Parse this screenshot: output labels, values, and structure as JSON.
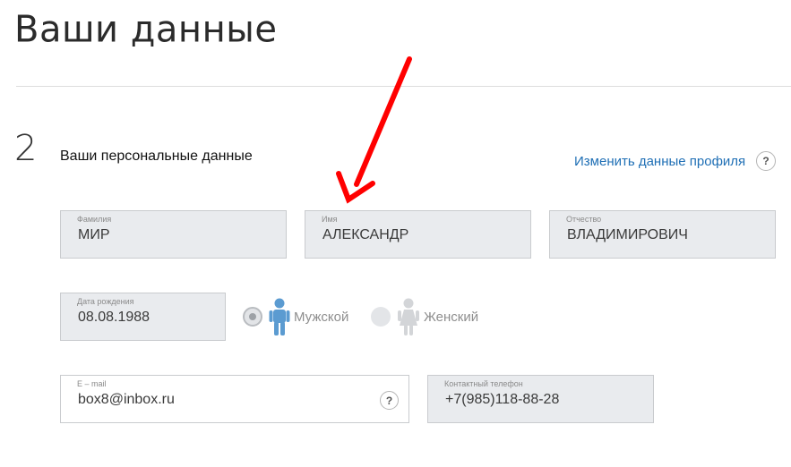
{
  "page": {
    "title": "Ваши данные"
  },
  "section": {
    "number": "2",
    "title": "Ваши персональные данные",
    "edit_link": "Изменить данные профиля",
    "help": "?"
  },
  "fields": {
    "surname": {
      "label": "Фамилия",
      "value": "МИР"
    },
    "name": {
      "label": "Имя",
      "value": "АЛЕКСАНДР"
    },
    "patronymic": {
      "label": "Отчество",
      "value": "ВЛАДИМИРОВИЧ"
    },
    "birth_date": {
      "label": "Дата рождения",
      "value": "08.08.1988"
    },
    "email": {
      "label": "E – mail",
      "value": "box8@inbox.ru",
      "help": "?"
    },
    "phone": {
      "label": "Контактный телефон",
      "value": "+7(985)118-88-28"
    }
  },
  "gender": {
    "selected": "male",
    "male": {
      "label": "Мужской",
      "icon": "male-person-icon",
      "color": "#5b9bd1"
    },
    "female": {
      "label": "Женский",
      "icon": "female-person-icon",
      "color": "#d3d5d8"
    }
  },
  "annotation": {
    "icon": "red-arrow-icon",
    "color": "#ff0000"
  }
}
